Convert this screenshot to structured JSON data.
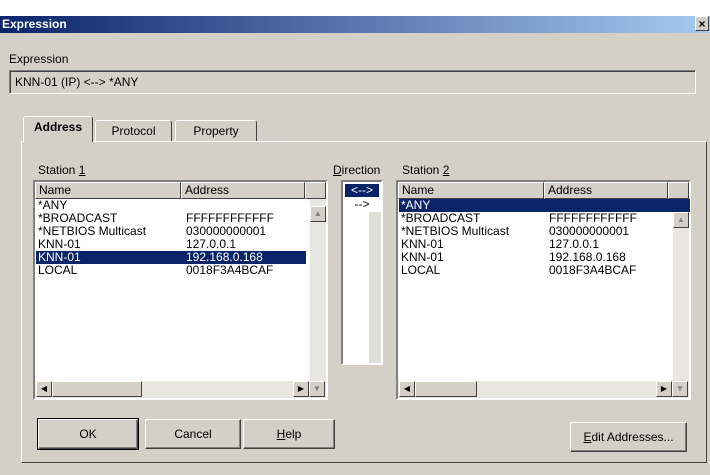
{
  "window": {
    "title": "Expression",
    "close_glyph": "×"
  },
  "expression": {
    "label": "Expression",
    "value": "KNN-01 (IP) <--> *ANY"
  },
  "tabs": [
    {
      "label": "Address",
      "active": true
    },
    {
      "label": "Protocol",
      "active": false
    },
    {
      "label": "Property",
      "active": false
    }
  ],
  "station1": {
    "label_prefix": "Station ",
    "label_key": "1",
    "columns": [
      "Name",
      "Address"
    ],
    "rows": [
      {
        "name": "*ANY",
        "address": "",
        "selected": false
      },
      {
        "name": "*BROADCAST",
        "address": "FFFFFFFFFFFF",
        "selected": false
      },
      {
        "name": "*NETBIOS Multicast",
        "address": "030000000001",
        "selected": false
      },
      {
        "name": "KNN-01",
        "address": "127.0.0.1",
        "selected": false
      },
      {
        "name": "KNN-01",
        "address": "192.168.0.168",
        "selected": true
      },
      {
        "name": "LOCAL",
        "address": "0018F3A4BCAF",
        "selected": false
      }
    ]
  },
  "direction": {
    "label_key": "D",
    "label_rest": "irection",
    "options": [
      {
        "label": "<-->",
        "selected": true
      },
      {
        "label": "-->",
        "selected": false
      }
    ]
  },
  "station2": {
    "label_prefix": "Station ",
    "label_key": "2",
    "columns": [
      "Name",
      "Address"
    ],
    "rows": [
      {
        "name": "*ANY",
        "address": "",
        "selected": true
      },
      {
        "name": "*BROADCAST",
        "address": "FFFFFFFFFFFF",
        "selected": false
      },
      {
        "name": "*NETBIOS Multicast",
        "address": "030000000001",
        "selected": false
      },
      {
        "name": "KNN-01",
        "address": "127.0.0.1",
        "selected": false
      },
      {
        "name": "KNN-01",
        "address": "192.168.0.168",
        "selected": false
      },
      {
        "name": "LOCAL",
        "address": "0018F3A4BCAF",
        "selected": false
      }
    ]
  },
  "buttons": {
    "ok": "OK",
    "cancel": "Cancel",
    "help_key": "H",
    "help_rest": "elp",
    "edit_key": "E",
    "edit_rest": "dit Addresses..."
  },
  "icons": {
    "scroll_up": "▲",
    "scroll_down": "▼",
    "scroll_left": "◀",
    "scroll_right": "▶"
  }
}
